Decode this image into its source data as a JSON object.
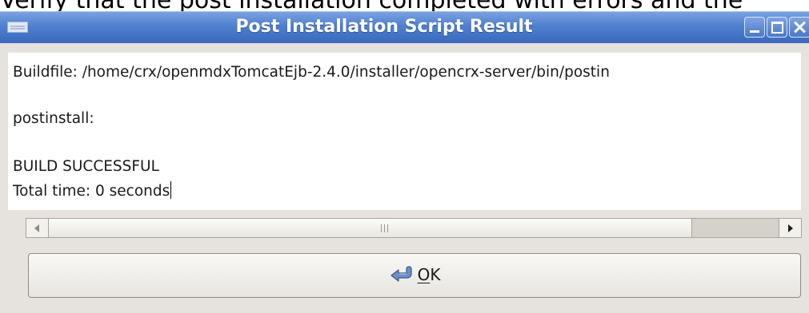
{
  "background": {
    "instruction_text": "Verify that the post installation completed with errors and the"
  },
  "dialog": {
    "title": "Post Installation Script Result",
    "output_lines": [
      "Buildfile: /home/crx/openmdxTomcatEjb-2.4.0/installer/opencrx-server/bin/postin",
      "postinstall:",
      "BUILD SUCCESSFUL",
      "Total time: 0 seconds"
    ],
    "ok_button": {
      "mnemonic": "O",
      "label_rest": "K"
    }
  },
  "icons": {
    "app": "window-app-icon",
    "minimize": "minimize-icon",
    "maximize": "maximize-icon",
    "close": "close-icon",
    "ok": "enter-arrow-icon"
  },
  "colors": {
    "titlebar": "#4f7fcf",
    "window_bg": "#e6e3de"
  },
  "scrollbar": {
    "horizontal_position": 0
  }
}
